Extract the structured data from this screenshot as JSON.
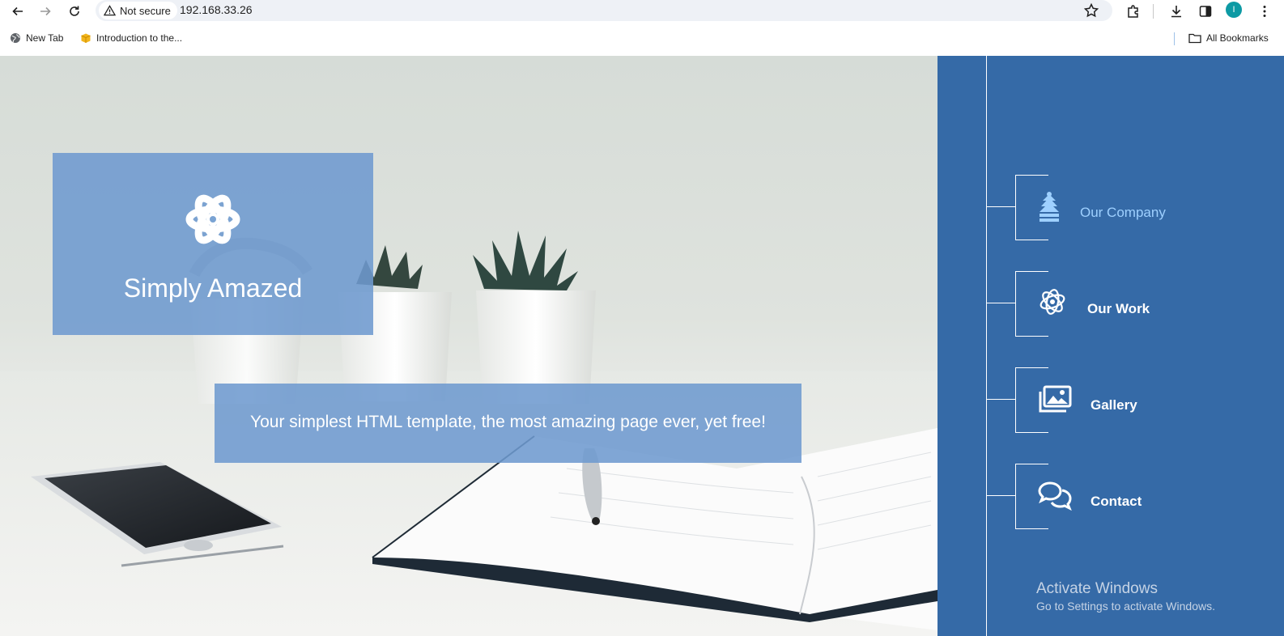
{
  "browser": {
    "security_label": "Not secure",
    "url": "192.168.33.26",
    "profile_initial": "I",
    "profile_color": "#0d9aa4"
  },
  "bookmarks": {
    "items": [
      {
        "label": "New Tab",
        "icon": "globe-icon"
      },
      {
        "label": "Introduction to the...",
        "icon": "package-icon"
      }
    ],
    "all_bookmarks_label": "All Bookmarks"
  },
  "hero": {
    "brand_icon": "atom-icon",
    "brand_title": "Simply Amazed",
    "tagline": "Your simplest HTML template, the most amazing page ever, yet free!"
  },
  "sidebar": {
    "background": "#356aa7",
    "items": [
      {
        "label": "Our Company",
        "icon": "tree-icon",
        "active": true
      },
      {
        "label": "Our Work",
        "icon": "atom-scribble-icon",
        "active": false
      },
      {
        "label": "Gallery",
        "icon": "images-icon",
        "active": false
      },
      {
        "label": "Contact",
        "icon": "chat-bubbles-icon",
        "active": false
      }
    ]
  },
  "watermark": {
    "title": "Activate Windows",
    "subtitle": "Go to Settings to activate Windows."
  },
  "colors": {
    "overlay_blue": "#6e9acf",
    "active_nav_text": "#9ed0ff"
  }
}
